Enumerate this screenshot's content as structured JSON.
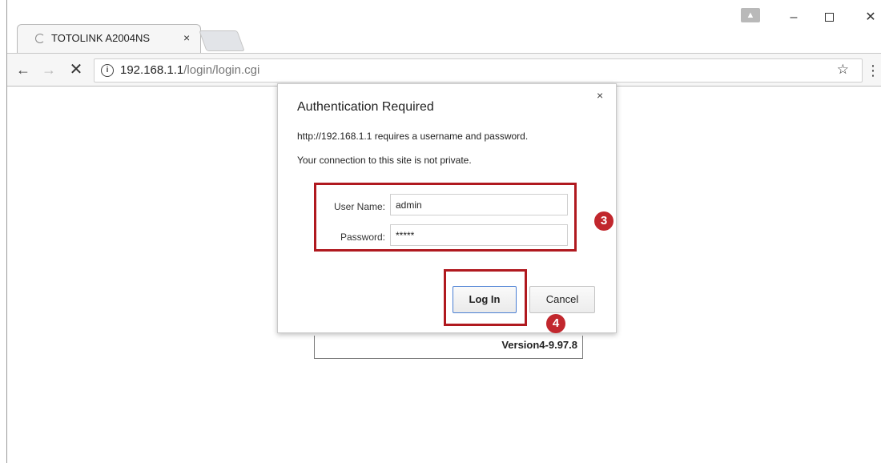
{
  "browser": {
    "tab_title": "TOTOLINK A2004NS",
    "tab_close": "×",
    "url_host": "192.168.1.1",
    "url_path": "/login/login.cgi",
    "profile_icon": "person-icon",
    "nav": {
      "back": "←",
      "forward": "→",
      "stop": "✕"
    },
    "star": "☆",
    "menu": "⋮",
    "window_controls": {
      "minimize": "–",
      "close": "✕"
    }
  },
  "dialog": {
    "title": "Authentication Required",
    "message_line1": "http://192.168.1.1 requires a username and password.",
    "message_line2": "Your connection to this site is not private.",
    "close": "×",
    "username_label": "User Name:",
    "username_value": "admin",
    "password_label": "Password:",
    "password_value": "*****",
    "login_button": "Log In",
    "cancel_button": "Cancel"
  },
  "page": {
    "version": "Version4-9.97.8"
  },
  "annotations": {
    "step3": "3",
    "step4": "4",
    "highlight_color": "#b0191f",
    "badge_color": "#c1272d"
  }
}
